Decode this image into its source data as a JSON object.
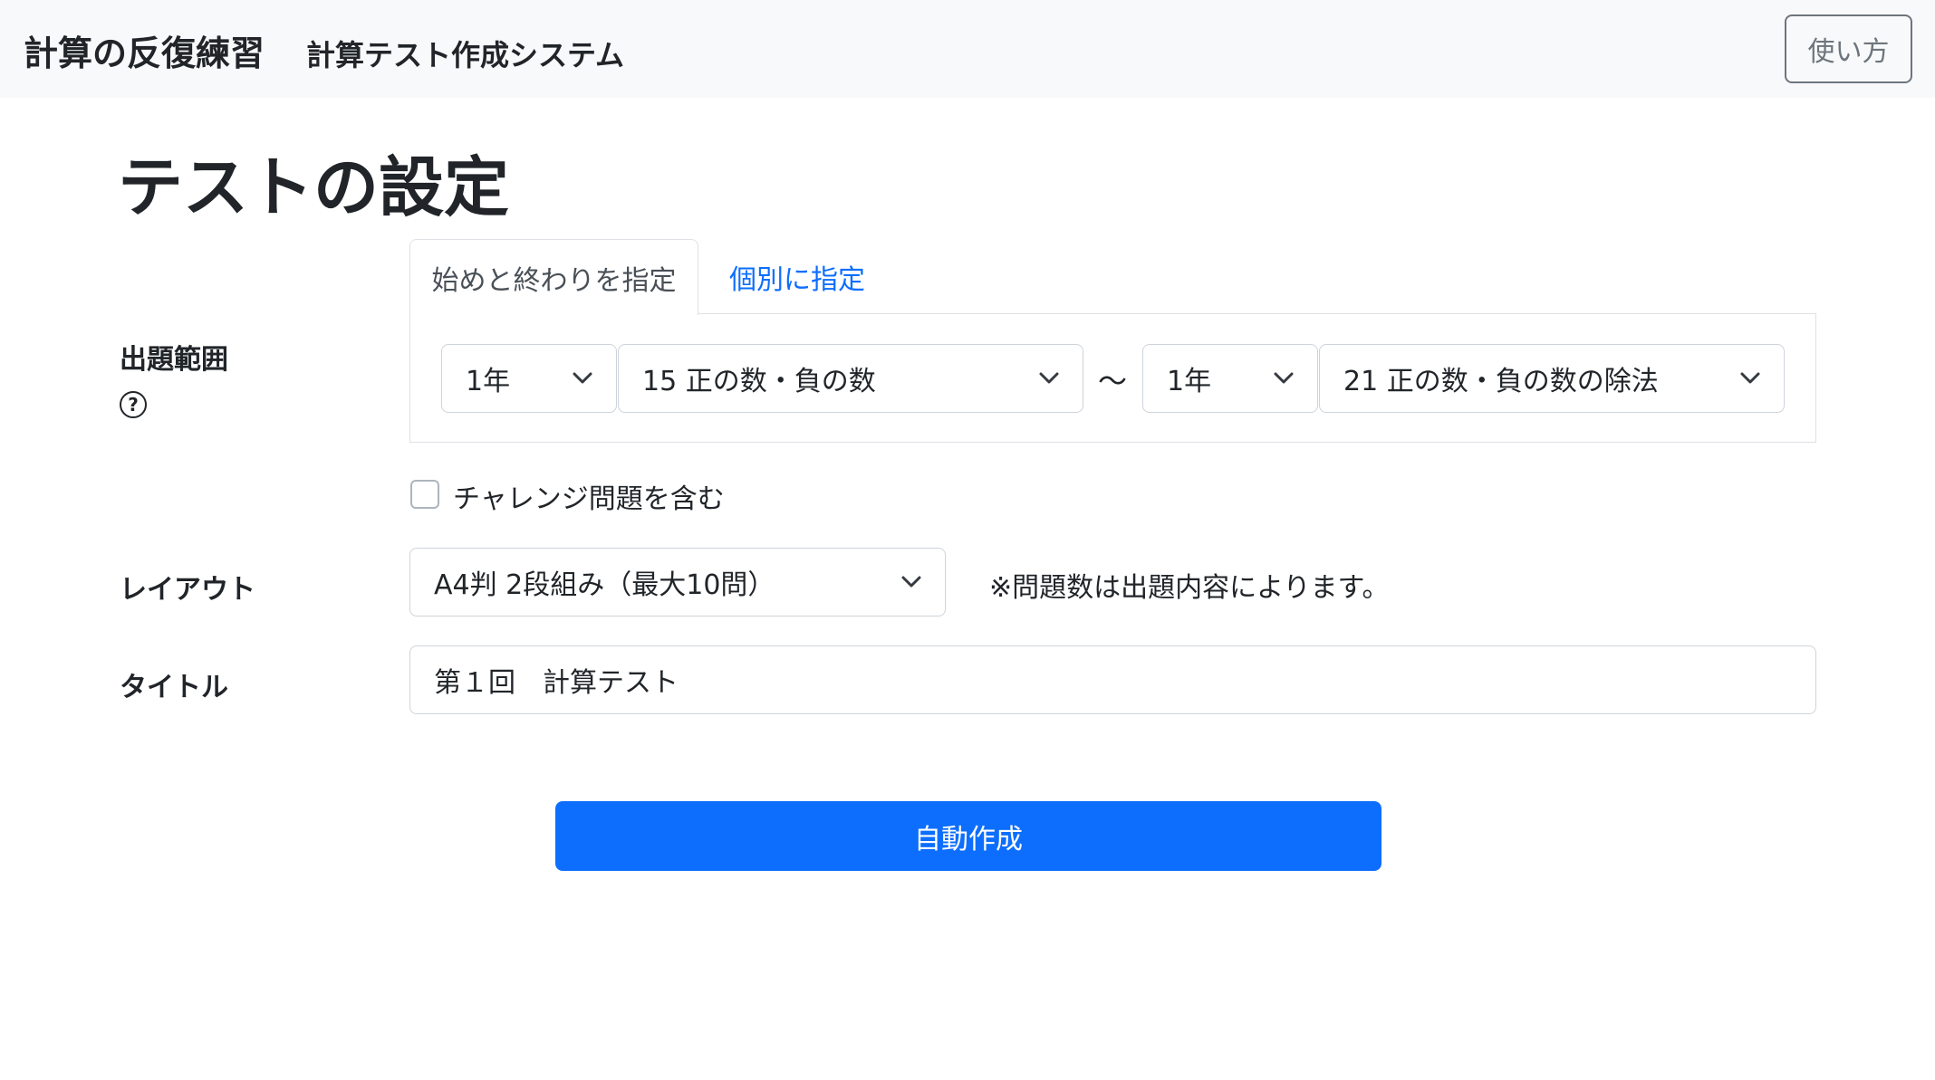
{
  "navbar": {
    "brand": "計算の反復練習",
    "subtitle": "計算テスト作成システム",
    "help_button": "使い方"
  },
  "page_title": "テストの設定",
  "range": {
    "label": "出題範囲",
    "help_icon": "?",
    "tabs": [
      {
        "label": "始めと終わりを指定",
        "active": true
      },
      {
        "label": "個別に指定",
        "active": false
      }
    ],
    "start_grade": "1年",
    "start_unit": "15 正の数・負の数",
    "separator": "～",
    "end_grade": "1年",
    "end_unit": "21 正の数・負の数の除法"
  },
  "challenge": {
    "label": "チャレンジ問題を含む",
    "checked": false
  },
  "layout": {
    "label": "レイアウト",
    "selected": "A4判 2段組み（最大10問）",
    "note": "※問題数は出題内容によります。"
  },
  "title_field": {
    "label": "タイトル",
    "value": "第１回　計算テスト"
  },
  "submit_button": "自動作成",
  "colors": {
    "primary": "#0d6efd",
    "navbar_bg": "#f8f9fa",
    "text": "#212529",
    "border": "#ced4da"
  },
  "icons": {
    "select_arrow": "chevron-down-icon",
    "help": "question-circle-icon"
  }
}
